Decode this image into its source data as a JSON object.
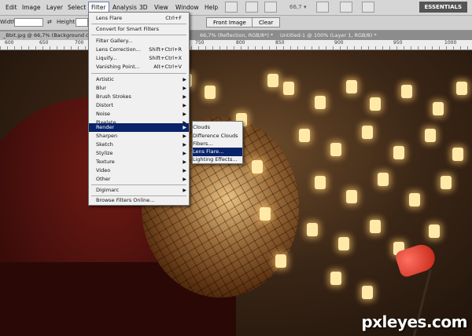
{
  "menubar": {
    "items": [
      "Edit",
      "Image",
      "Layer",
      "Select",
      "Filter",
      "Analysis",
      "3D",
      "View",
      "Window",
      "Help"
    ],
    "zoom": "66,7",
    "workspace": "ESSENTIALS"
  },
  "options": {
    "width_label": "Width:",
    "height_label": "Height:",
    "front_image": "Front Image",
    "clear": "Clear"
  },
  "tabs": [
    "_Bbit.jpg @ 66,7% (Background copy...",
    "66,7% (Reflection, RGB/8*) *",
    "Untitled-1 @ 100% (Layer 1, RGB/8) *"
  ],
  "ruler": {
    "labels": [
      "600",
      "650",
      "700",
      "750",
      "800",
      "850",
      "900",
      "950",
      "1000"
    ]
  },
  "filter_menu": {
    "items": [
      {
        "label": "Lens Flare",
        "shortcut": "Ctrl+F"
      },
      {
        "label": "Convert for Smart Filters"
      },
      {
        "label": "Filter Gallery..."
      },
      {
        "label": "Lens Correction...",
        "shortcut": "Shift+Ctrl+R"
      },
      {
        "label": "Liquify...",
        "shortcut": "Shift+Ctrl+X"
      },
      {
        "label": "Vanishing Point...",
        "shortcut": "Alt+Ctrl+V"
      },
      {
        "label": "Artistic"
      },
      {
        "label": "Blur"
      },
      {
        "label": "Brush Strokes"
      },
      {
        "label": "Distort"
      },
      {
        "label": "Noise"
      },
      {
        "label": "Pixelate"
      },
      {
        "label": "Render"
      },
      {
        "label": "Sharpen"
      },
      {
        "label": "Sketch"
      },
      {
        "label": "Stylize"
      },
      {
        "label": "Texture"
      },
      {
        "label": "Video"
      },
      {
        "label": "Other"
      },
      {
        "label": "Digimarc"
      },
      {
        "label": "Browse Filters Online..."
      }
    ]
  },
  "render_submenu": {
    "items": [
      "Clouds",
      "Difference Clouds",
      "Fibers...",
      "Lens Flare...",
      "Lighting Effects..."
    ]
  },
  "watermark": "pxleyes.com",
  "colors": {
    "highlight": "#0a246a",
    "menu_bg": "#f0f0f0",
    "lamp": "#d83020"
  }
}
